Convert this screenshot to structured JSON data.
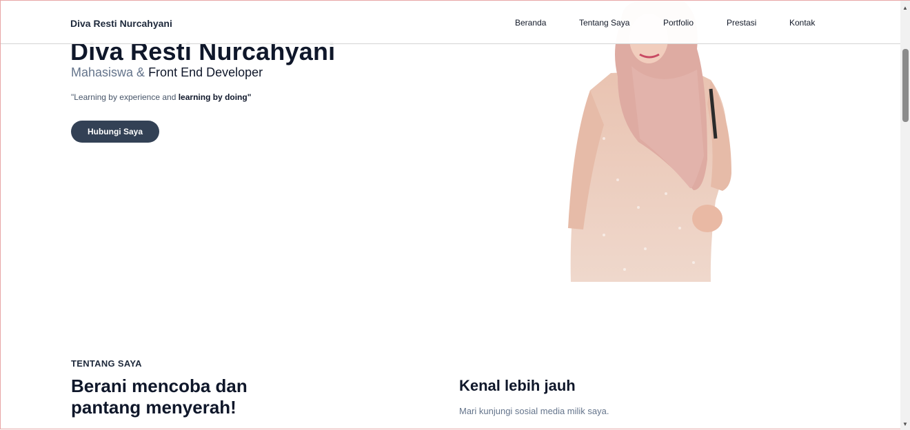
{
  "nav": {
    "brand": "Diva Resti Nurcahyani",
    "links": [
      "Beranda",
      "Tentang Saya",
      "Portfolio",
      "Prestasi",
      "Kontak"
    ]
  },
  "hero": {
    "name": "Diva Resti Nurcahyani",
    "subtitle_muted": "Mahasiswa &",
    "subtitle_strong": "Front End Developer",
    "quote_plain": "\"Learning by experience and",
    "quote_bold": "learning by doing\"",
    "cta_label": "Hubungi Saya"
  },
  "about": {
    "eyebrow": "TENTANG SAYA",
    "title_line1": "Berani mencoba dan",
    "title_line2": "pantang menyerah!",
    "side_title": "Kenal lebih jauh",
    "side_text": "Mari kunjungi sosial media milik saya."
  },
  "colors": {
    "accent": "#334155",
    "text": "#0f172a",
    "muted": "#64748b"
  }
}
